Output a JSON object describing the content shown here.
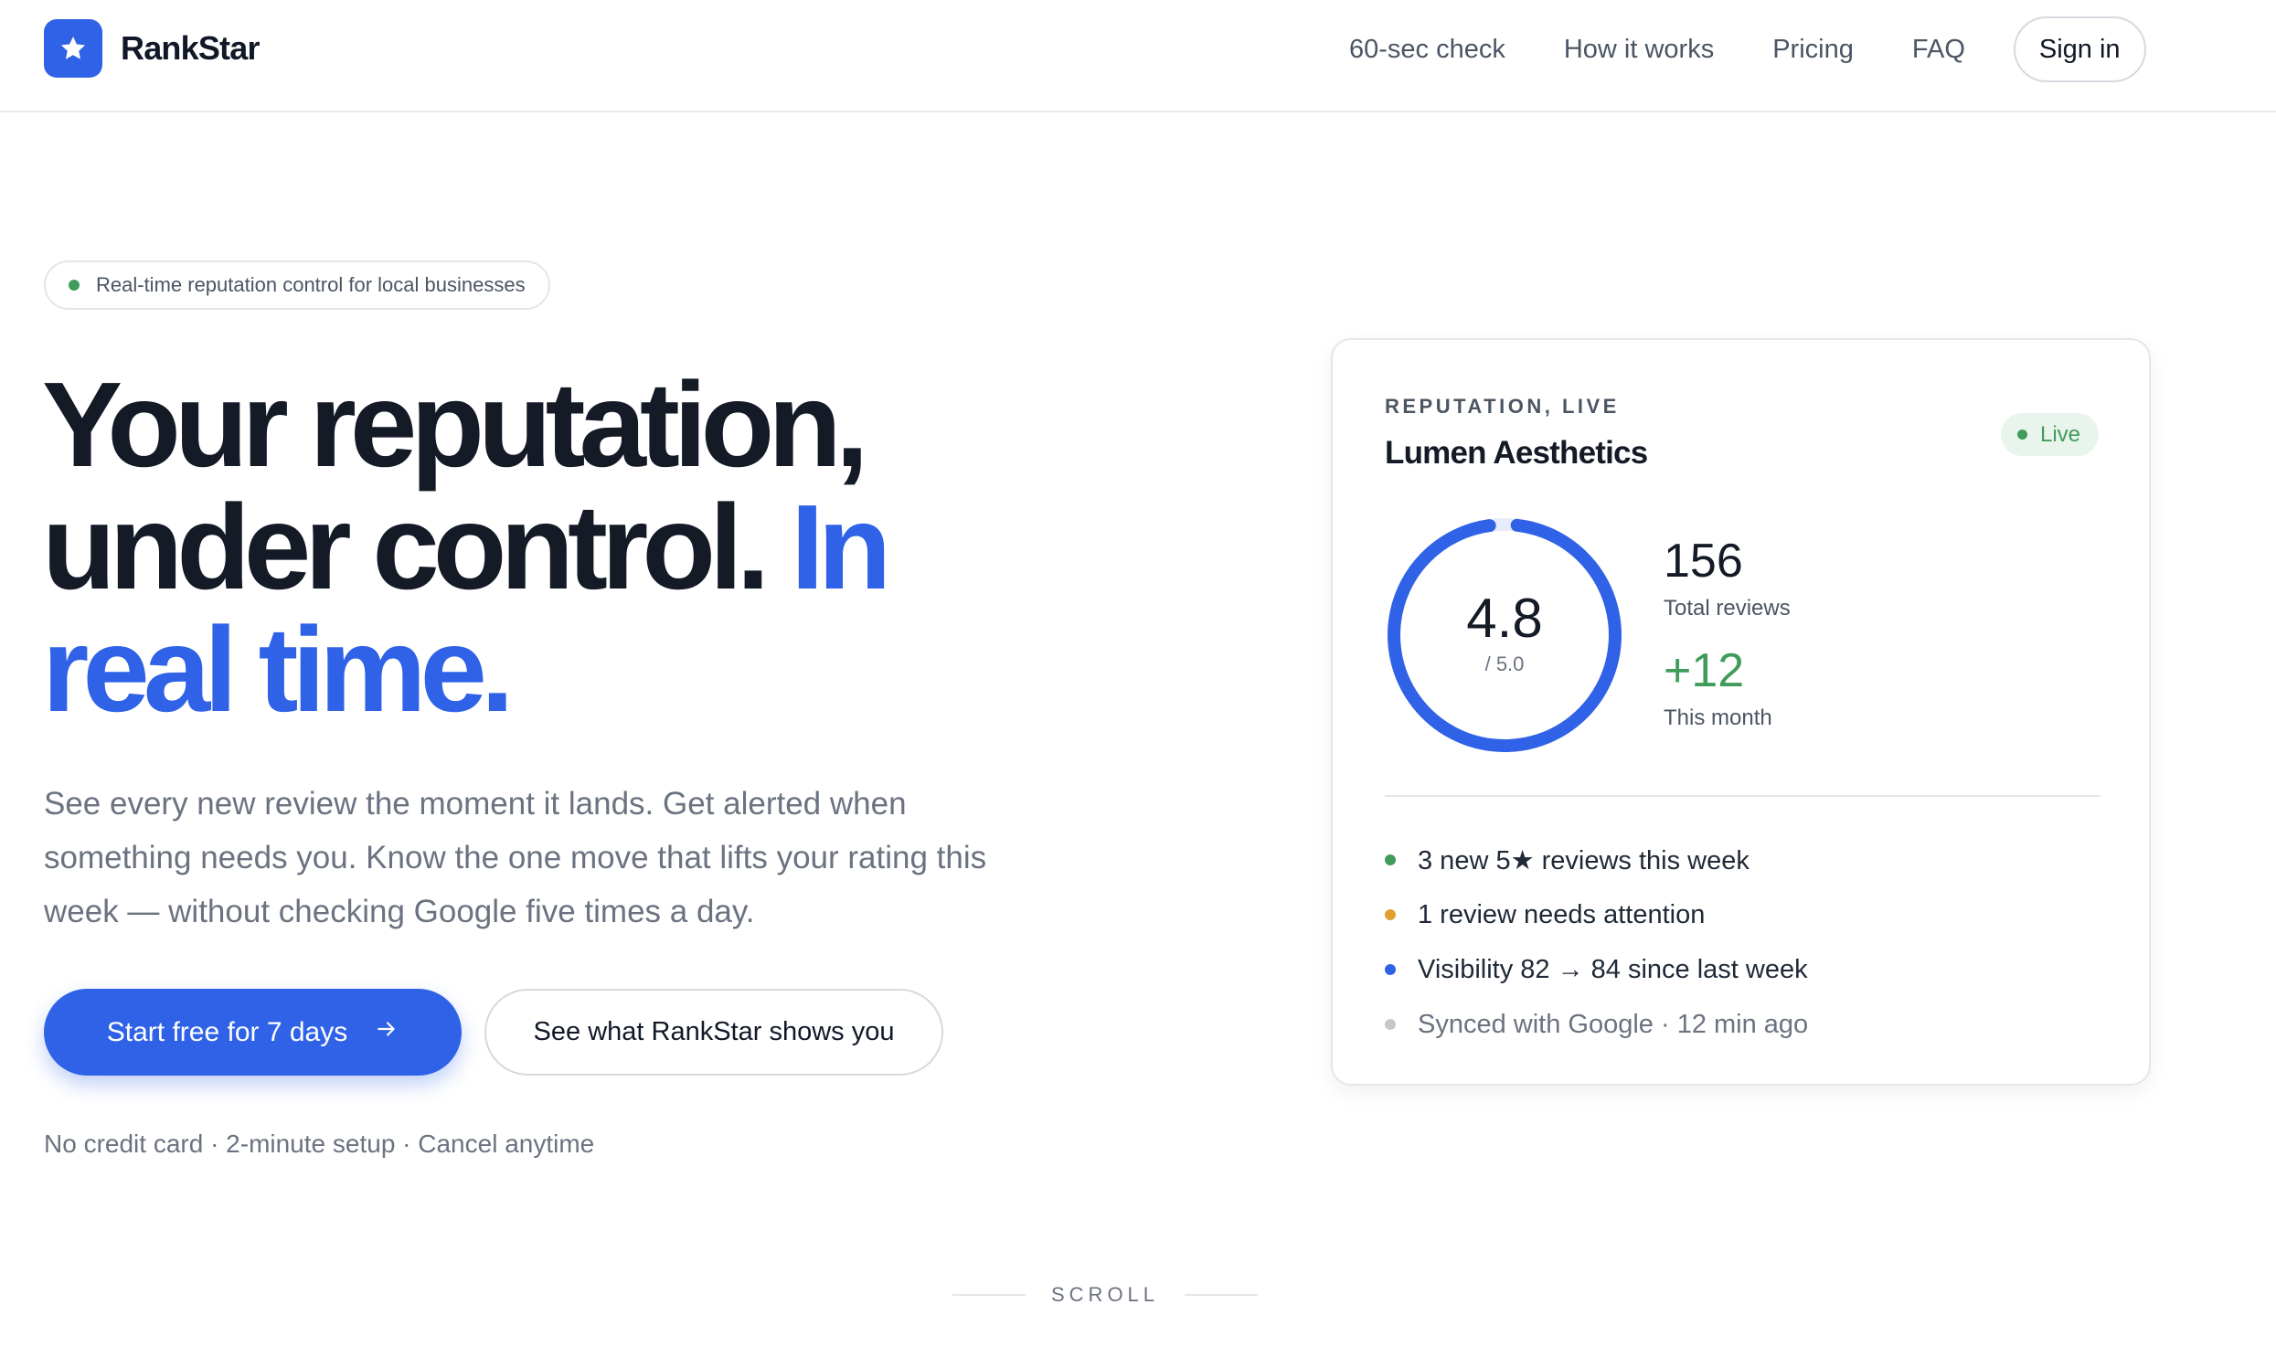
{
  "brand": {
    "name": "RankStar",
    "accent": "#2f62e6",
    "logo_icon": "star-icon"
  },
  "nav": {
    "links": [
      "60-sec check",
      "How it works",
      "Pricing",
      "FAQ"
    ],
    "signin": "Sign in"
  },
  "hero": {
    "badge": "Real-time reputation control for local businesses",
    "headline_line1": "Your reputation,",
    "headline_line2": "under control.",
    "headline_accent_1": "In",
    "headline_accent_2": "real time.",
    "subtext": "See every new review the moment it lands. Get alerted when something needs you. Know the one move that lifts your rating this week — without checking Google five times a day.",
    "cta_primary": "Start free for 7 days",
    "cta_primary_icon": "arrow-right-icon",
    "cta_secondary": "See what RankStar shows you",
    "fineprint": "No credit card · 2-minute setup · Cancel anytime"
  },
  "card": {
    "eyebrow": "REPUTATION, LIVE",
    "business": "Lumen Aesthetics",
    "status": "Live",
    "rating": "4.8",
    "rating_max": "/ 5.0",
    "rating_fraction": 0.96,
    "total_reviews": "156",
    "total_reviews_label": "Total reviews",
    "month_delta": "+12",
    "month_delta_label": "This month",
    "items": [
      {
        "text": "3 new 5★ reviews this week",
        "color": "#3f9c5a"
      },
      {
        "text": "1 review needs attention",
        "color": "#e0a030"
      },
      {
        "text": "Visibility 82 → 84 since last week",
        "color": "#2f62e6"
      },
      {
        "text": "Synced with Google · 12 min ago",
        "color": "#c4c7cc"
      }
    ]
  },
  "scroll_label": "SCROLL"
}
